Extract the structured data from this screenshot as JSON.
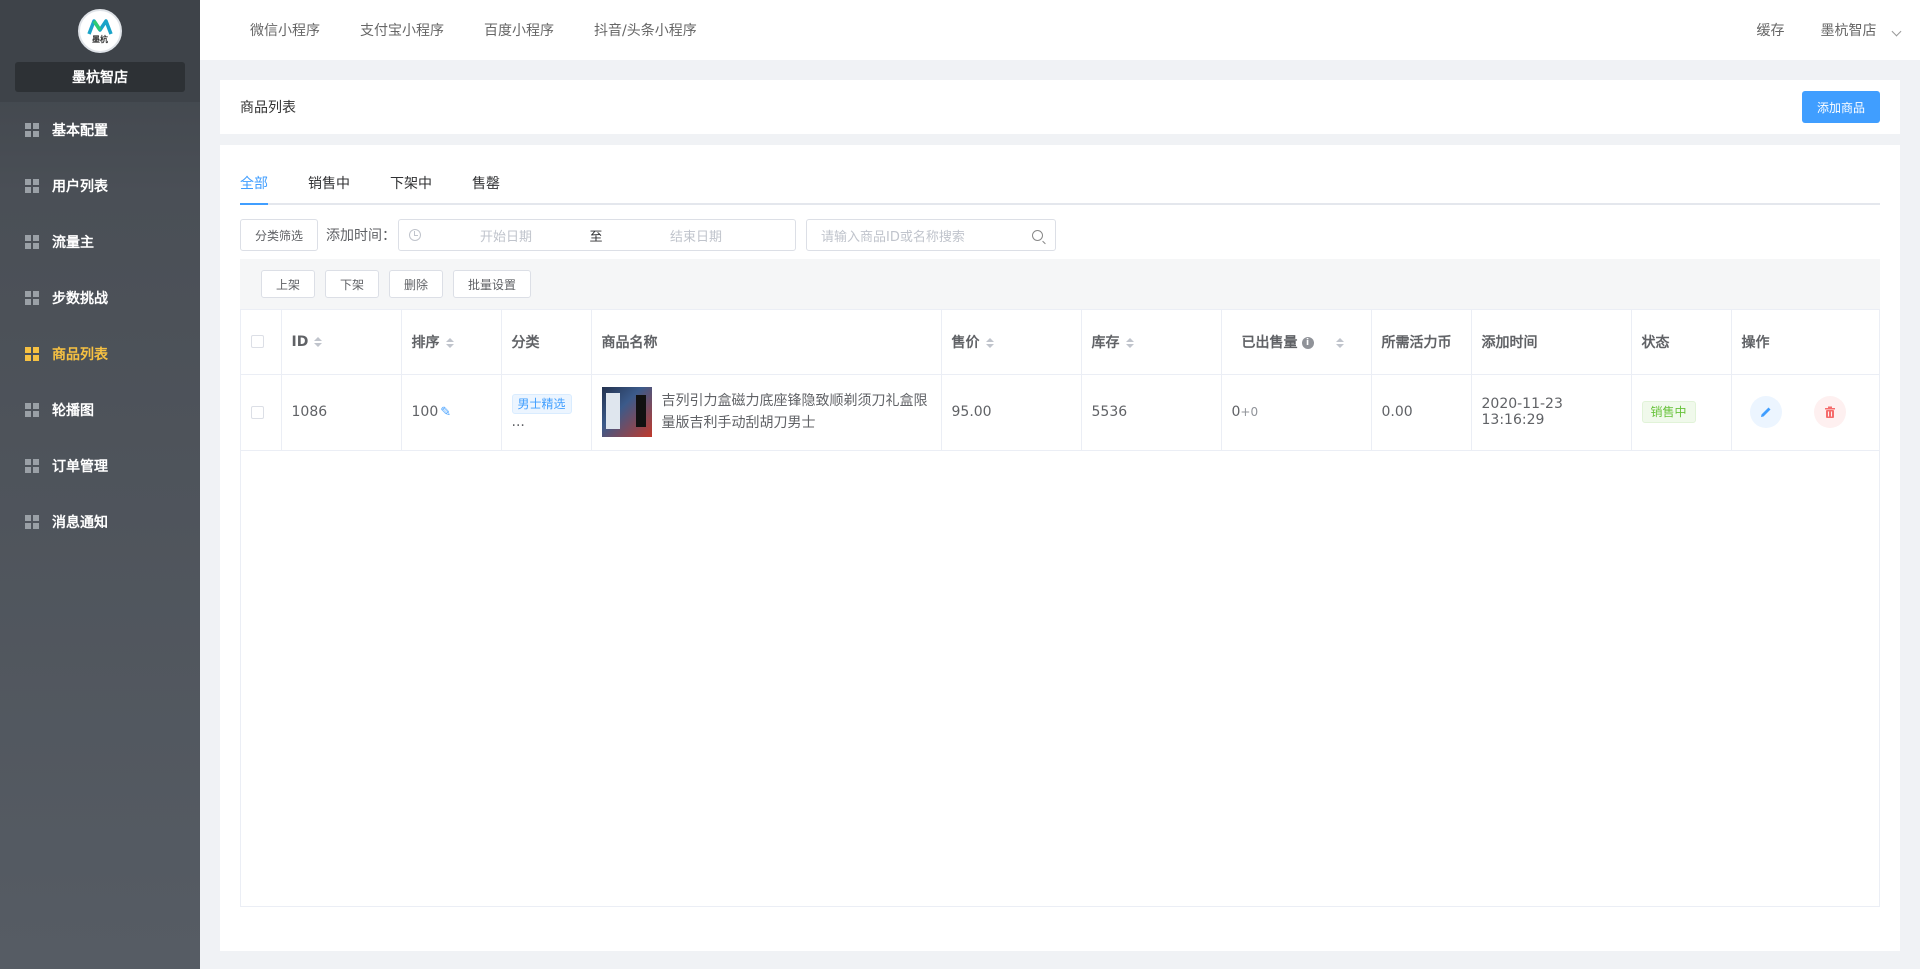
{
  "sidebar": {
    "logo_text": "墨杭",
    "store_name": "墨杭智店",
    "items": [
      {
        "label": "基本配置"
      },
      {
        "label": "用户列表"
      },
      {
        "label": "流量主"
      },
      {
        "label": "步数挑战"
      },
      {
        "label": "商品列表",
        "active": true
      },
      {
        "label": "轮播图"
      },
      {
        "label": "订单管理"
      },
      {
        "label": "消息通知"
      }
    ]
  },
  "topbar": {
    "nav": [
      "微信小程序",
      "支付宝小程序",
      "百度小程序",
      "抖音/头条小程序"
    ],
    "cache": "缓存",
    "user": "墨杭智店"
  },
  "header": {
    "title": "商品列表",
    "add_button": "添加商品"
  },
  "tabs": [
    "全部",
    "销售中",
    "下架中",
    "售罄"
  ],
  "filters": {
    "category_button": "分类筛选",
    "date_label": "添加时间：",
    "start_placeholder": "开始日期",
    "separator": "至",
    "end_placeholder": "结束日期",
    "search_placeholder": "请输入商品ID或名称搜索"
  },
  "toolbar": [
    "上架",
    "下架",
    "删除",
    "批量设置"
  ],
  "table": {
    "columns": [
      "ID",
      "排序",
      "分类",
      "商品名称",
      "售价",
      "库存",
      "已出售量",
      "所需活力币",
      "添加时间",
      "状态",
      "操作"
    ],
    "rows": [
      {
        "id": "1086",
        "sort": "100",
        "category": "男士精选",
        "category_more": "...",
        "name": "吉列引力盒磁力底座锋隐致顺剃须刀礼盒限量版吉利手动刮胡刀男士",
        "price": "95.00",
        "stock": "5536",
        "sold": "0",
        "sold_extra": "+0",
        "coins": "0.00",
        "created": "2020-11-23 13:16:29",
        "status": "销售中"
      }
    ]
  },
  "colors": {
    "primary": "#409eff",
    "active_menu": "#f6c142",
    "success": "#67c23a",
    "danger": "#f56c6c"
  }
}
